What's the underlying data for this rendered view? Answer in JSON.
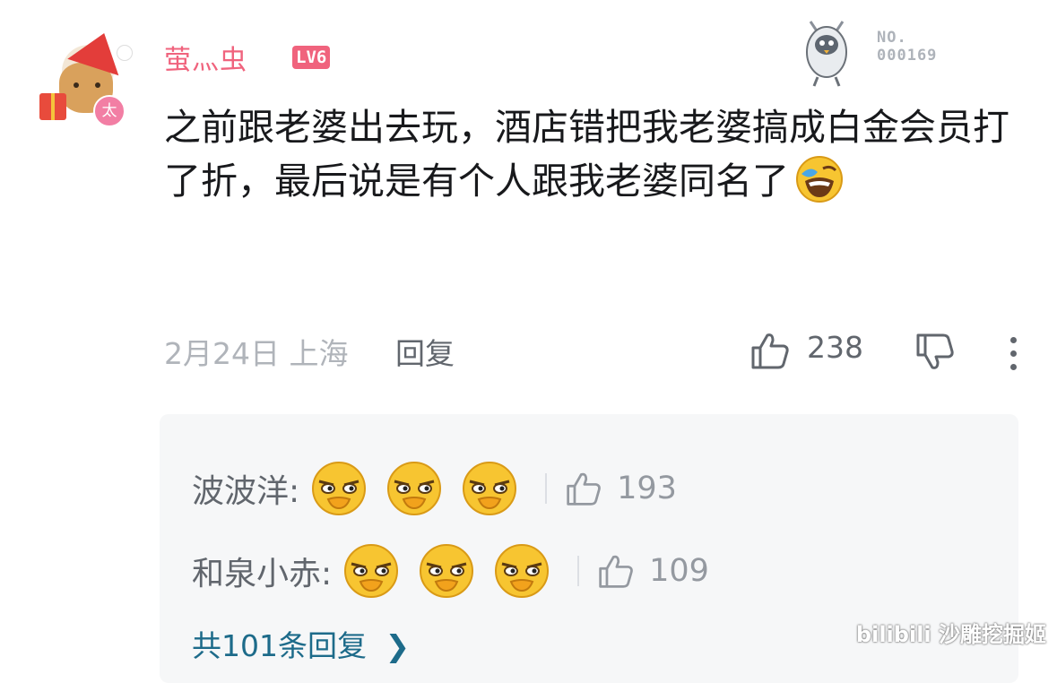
{
  "comment": {
    "username": "萤灬虫",
    "level": "LV6",
    "avatar_badge": "太",
    "decoration_number": "NO.\n000169",
    "text": "之前跟老婆出去玩，酒店错把我老婆搞成白金会员打了折，最后说是有个人跟我老婆同名了",
    "inline_emoji": "laughing-cry-emoji",
    "date": "2月24日",
    "location": "上海",
    "reply_label": "回复",
    "like_count": "238"
  },
  "replies": [
    {
      "name": "波波洋:",
      "emojis": [
        "smirk-emoji",
        "smirk-emoji",
        "smirk-emoji"
      ],
      "like_count": "193"
    },
    {
      "name": "和泉小赤:",
      "emojis": [
        "smirk-emoji",
        "smirk-emoji",
        "smirk-emoji"
      ],
      "like_count": "109"
    }
  ],
  "more_replies_label": "共101条回复",
  "watermark": "bilibili 沙雕挖掘姬",
  "colors": {
    "username": "#f0637d",
    "level_badge": "#f0637d",
    "more_replies": "#1d6b8a",
    "reply_box_bg": "#f6f7f8"
  }
}
